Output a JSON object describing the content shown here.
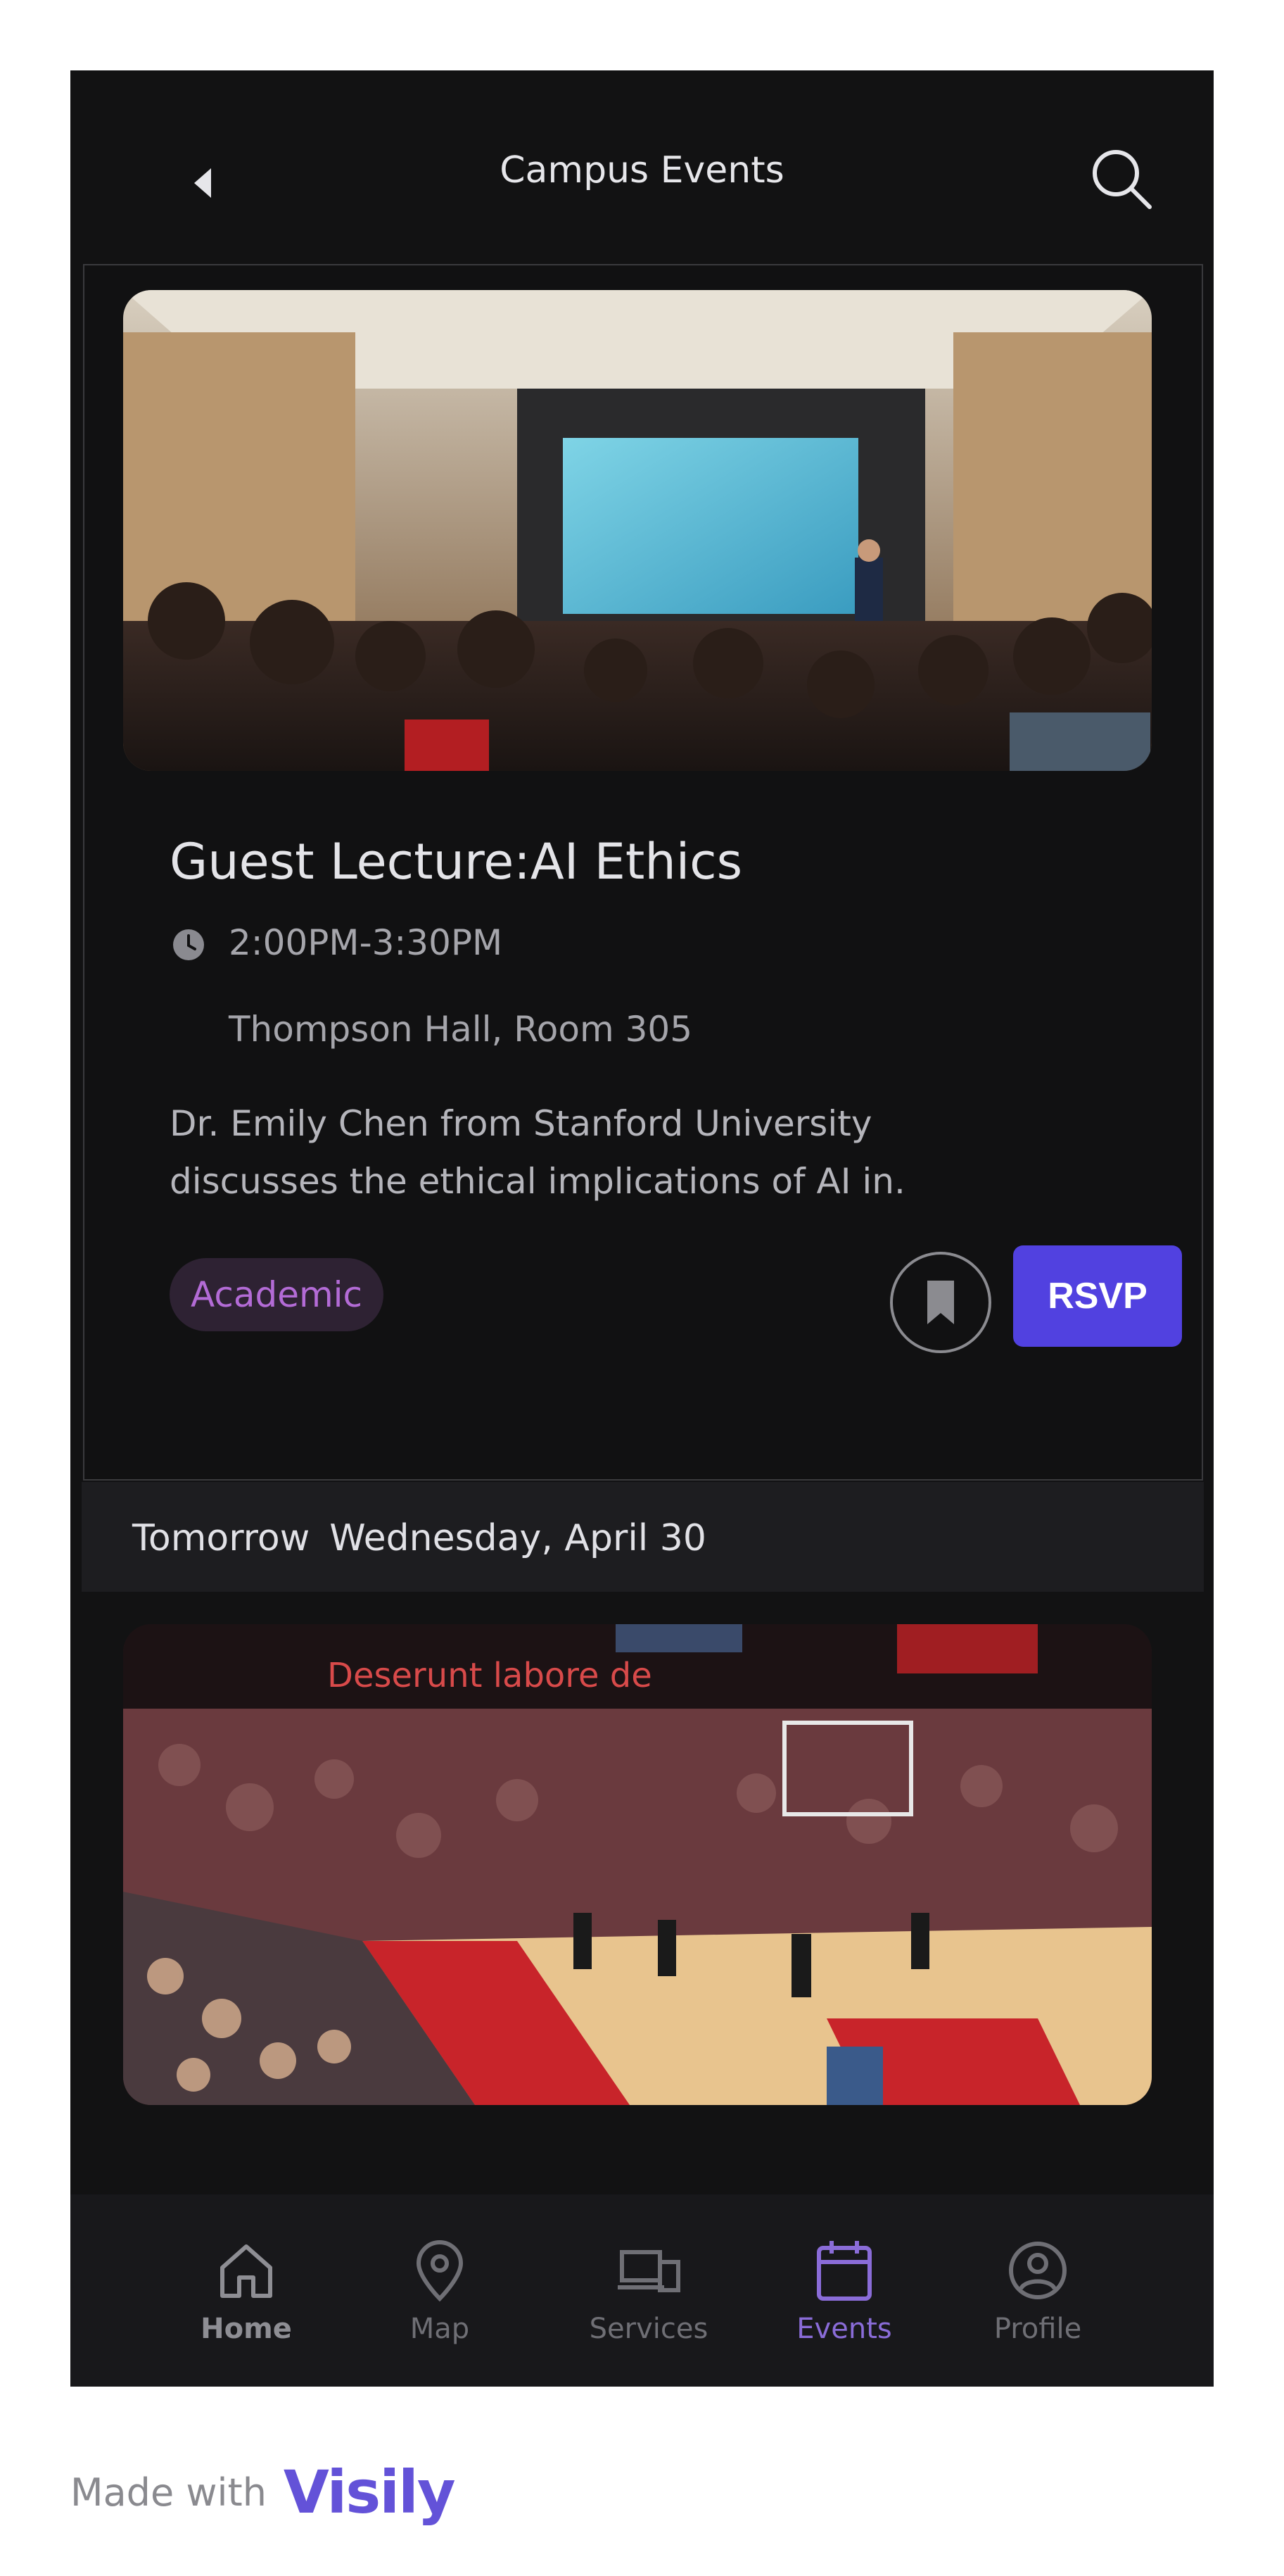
{
  "header": {
    "title": "Campus Events",
    "back_icon": "back-icon",
    "search_icon": "search-icon"
  },
  "events": [
    {
      "title": "Guest Lecture:AI Ethics",
      "time": "2:00PM-3:30PM",
      "location": "Thompson Hall, Room 305",
      "description": "Dr. Emily Chen from Stanford University discusses the ethical implications of AI in.",
      "tag": "Academic",
      "rsvp_label": "RSVP",
      "bookmark_icon": "bookmark-icon",
      "clock_icon": "clock-icon"
    },
    {
      "image_overlay": "Deserunt labore de"
    }
  ],
  "date_bar": {
    "relative": "Tomorrow",
    "date": "Wednesday, April 30"
  },
  "bottom_nav": {
    "items": [
      {
        "label": "Home",
        "icon": "home-icon",
        "active": false
      },
      {
        "label": "Map",
        "icon": "map-pin-icon",
        "active": false
      },
      {
        "label": "Services",
        "icon": "devices-icon",
        "active": false
      },
      {
        "label": "Events",
        "icon": "calendar-icon",
        "active": true
      },
      {
        "label": "Profile",
        "icon": "profile-icon",
        "active": false
      }
    ]
  },
  "footer": {
    "made_with": "Made with",
    "brand": "Visily"
  },
  "colors": {
    "background": "#121213",
    "accent": "#5141e0",
    "tag_bg": "#2e2233",
    "tag_text": "#b36bd6",
    "active_nav": "#8a6cd8"
  }
}
